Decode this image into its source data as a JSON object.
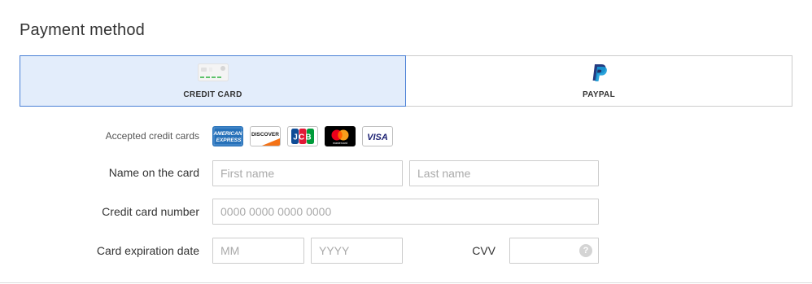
{
  "section": {
    "title": "Payment method"
  },
  "tabs": [
    {
      "label": "CREDIT CARD",
      "icon": "credit-card-icon",
      "selected": true
    },
    {
      "label": "PAYPAL",
      "icon": "paypal-logo-icon",
      "selected": false
    }
  ],
  "accepted_cards": {
    "label": "Accepted credit cards",
    "logos": [
      {
        "name": "amex",
        "text_top": "AMERICAN",
        "text_bottom": "EXPRESS",
        "color": "#2671b9"
      },
      {
        "name": "discover",
        "text": "DISCOVER",
        "color": "#f47216"
      },
      {
        "name": "jcb",
        "text": "JCB"
      },
      {
        "name": "mastercard",
        "text": "mastercard"
      },
      {
        "name": "visa",
        "text": "VISA",
        "color": "#1a1f71"
      }
    ]
  },
  "name_on_card": {
    "label": "Name on the card",
    "first_placeholder": "First name",
    "last_placeholder": "Last name"
  },
  "card_number": {
    "label": "Credit card number",
    "placeholder": "0000 0000 0000 0000"
  },
  "expiration": {
    "label": "Card expiration date",
    "month_placeholder": "MM",
    "year_placeholder": "YYYY"
  },
  "cvv": {
    "label": "CVV",
    "help_text": "?"
  },
  "colors": {
    "selected_tab_bg": "#e3edfb",
    "selected_tab_border": "#4a80d6",
    "input_border": "#cccccc",
    "placeholder": "#aaaaaa"
  }
}
